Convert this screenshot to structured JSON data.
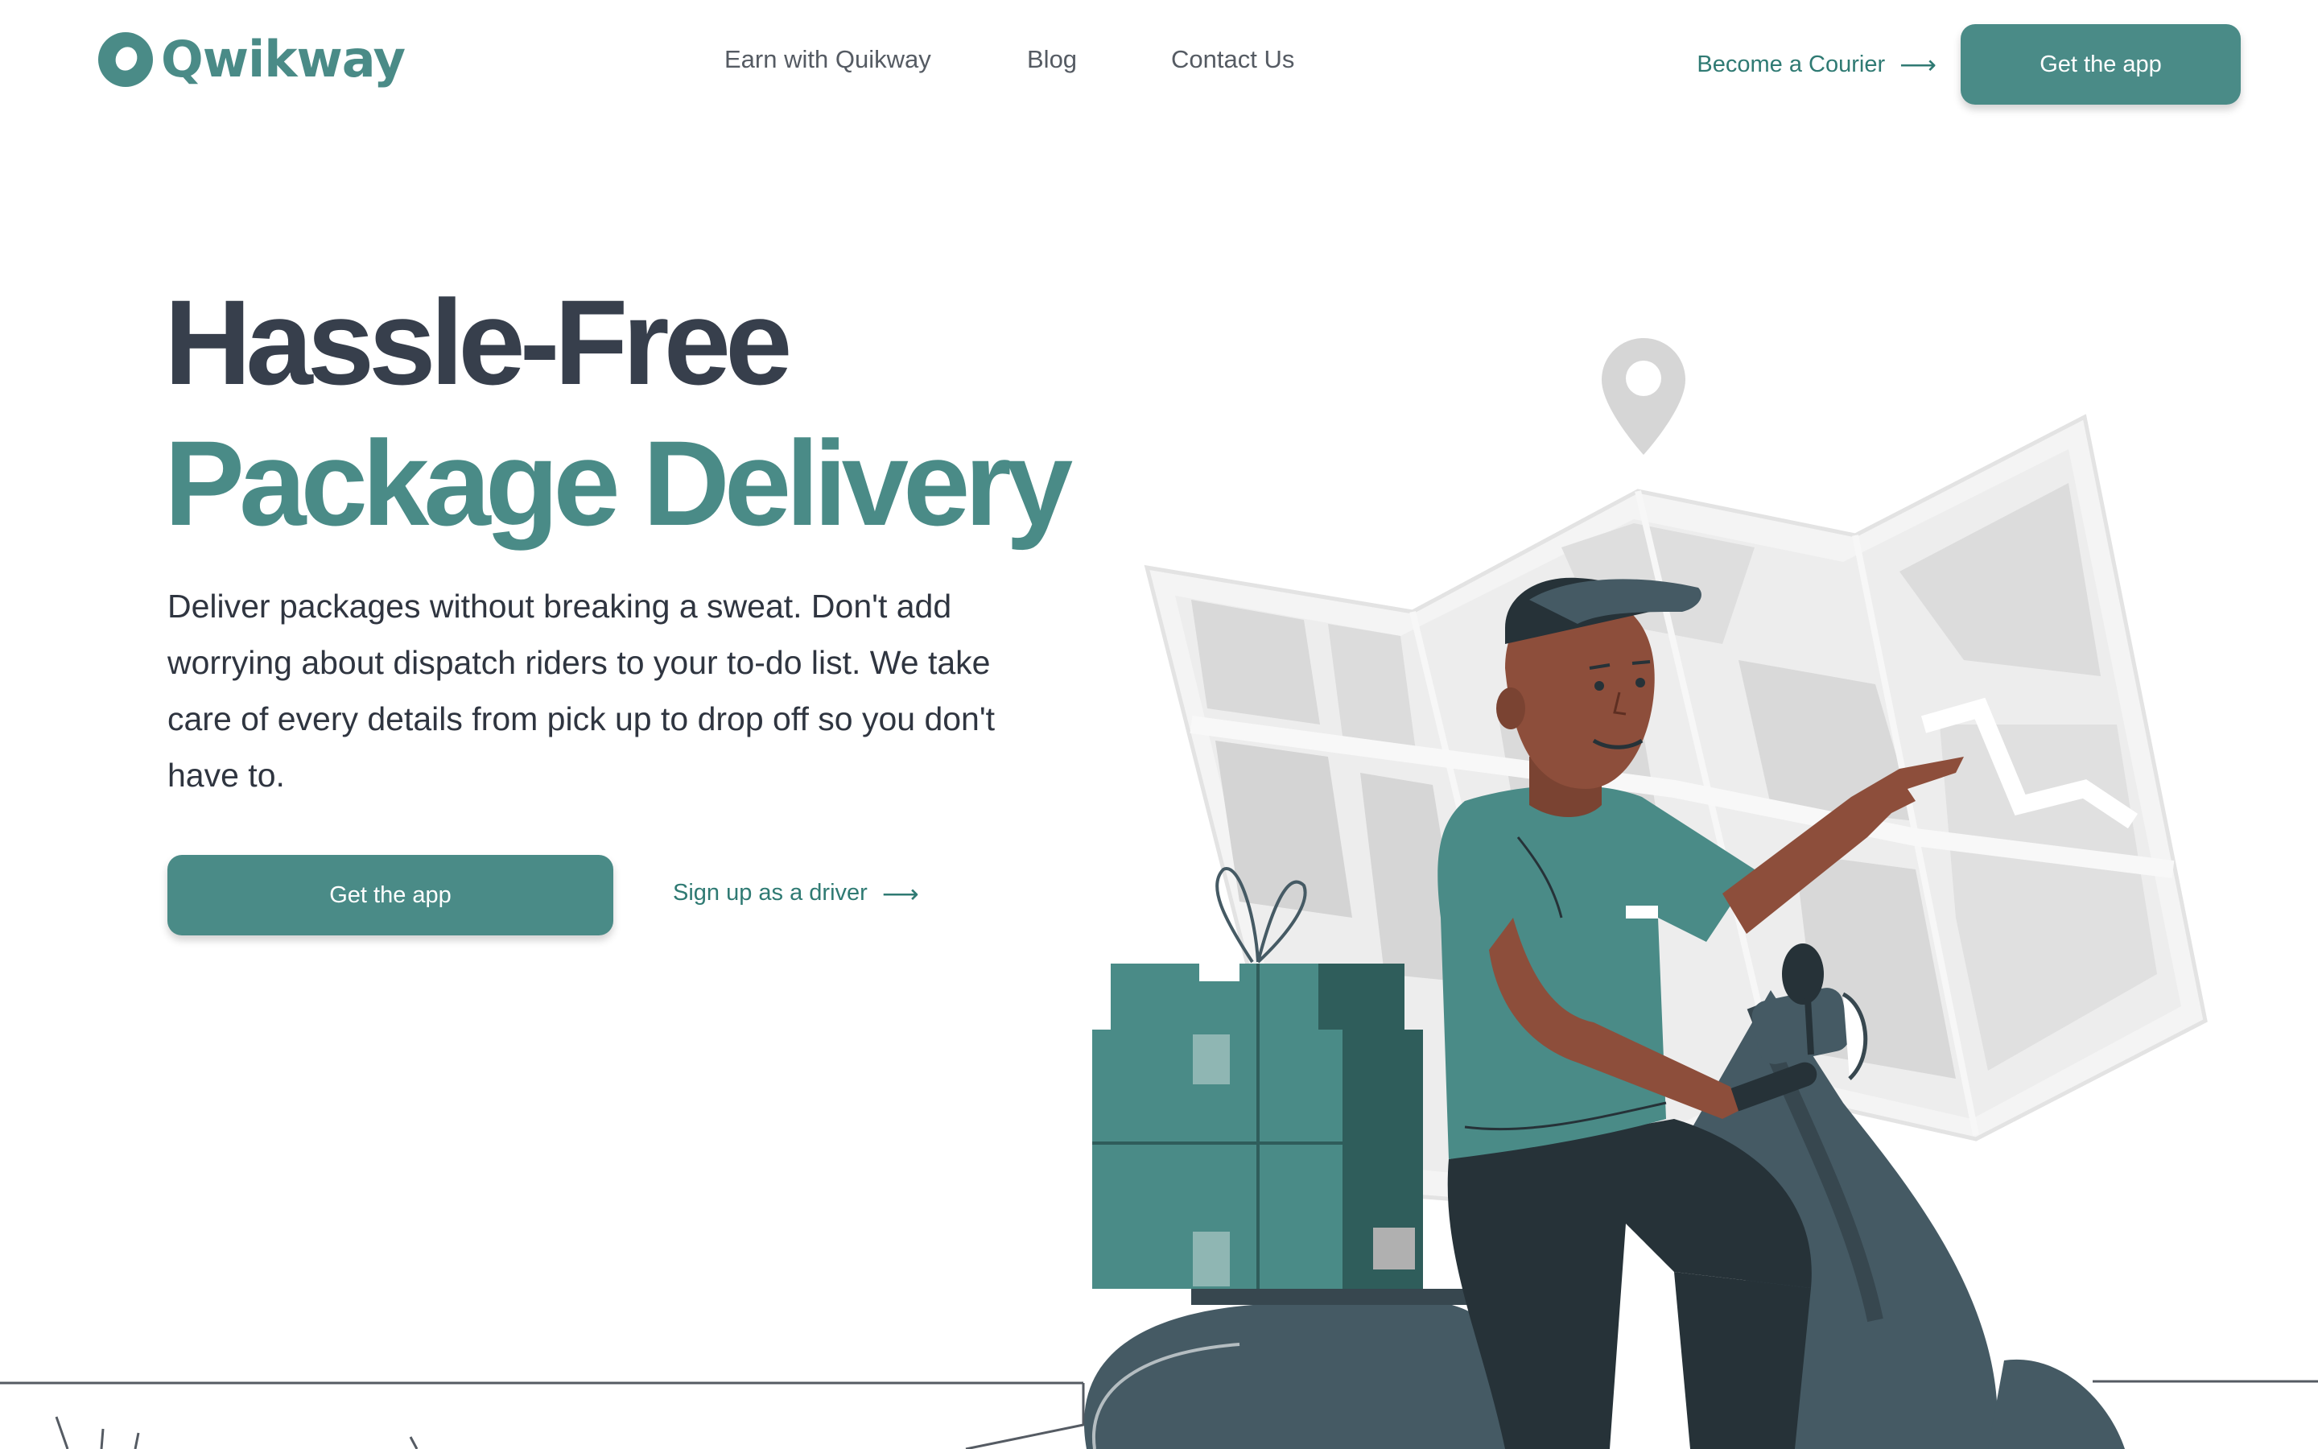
{
  "brand": {
    "name": "Qwikway",
    "accent_color": "#4a8b87",
    "logo_icon": "ring-logo-icon"
  },
  "nav": {
    "items": [
      {
        "label": "Earn with Quikway"
      },
      {
        "label": "Blog"
      },
      {
        "label": "Contact Us"
      }
    ]
  },
  "header": {
    "courier_link": "Become a Courier",
    "courier_link_icon": "arrow-right-icon",
    "cta": "Get the app"
  },
  "hero": {
    "title_line1": "Hassle-Free",
    "title_line2": "Package Delivery",
    "description": "Deliver packages without breaking a sweat. Don't add worrying about dispatch riders to your to-do list. We take care of every details from pick up to drop off so you don't have to.",
    "cta": "Get the app",
    "driver_link": "Sign up as a driver",
    "driver_link_icon": "arrow-right-icon",
    "title_color": "#373f4c"
  },
  "illustration": {
    "name": "courier-on-scooter-illustration",
    "elements": [
      "map-pin-icon",
      "folded-map",
      "courier",
      "package-boxes",
      "scooter"
    ]
  }
}
